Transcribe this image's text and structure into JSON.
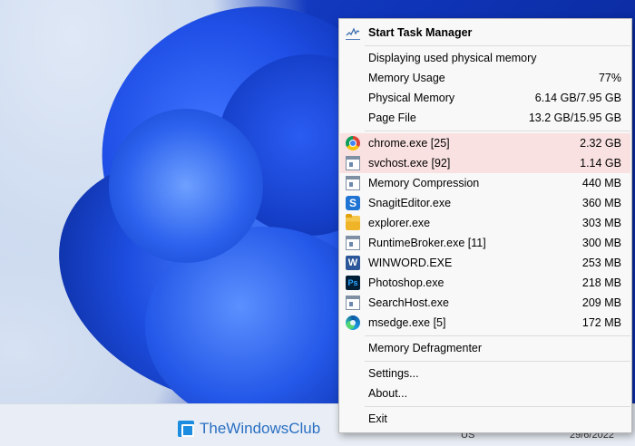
{
  "menu": {
    "header": {
      "label": "Start Task Manager",
      "icon": "task-manager-icon"
    },
    "info_title": "Displaying used physical memory",
    "stats": [
      {
        "label": "Memory Usage",
        "value": "77%"
      },
      {
        "label": "Physical Memory",
        "value": "6.14 GB/7.95 GB"
      },
      {
        "label": "Page File",
        "value": "13.2 GB/15.95 GB"
      }
    ],
    "processes": [
      {
        "label": "chrome.exe [25]",
        "value": "2.32 GB",
        "icon": "chrome-icon",
        "highlight": true
      },
      {
        "label": "svchost.exe [92]",
        "value": "1.14 GB",
        "icon": "window-app-icon",
        "highlight": true
      },
      {
        "label": "Memory Compression",
        "value": "440 MB",
        "icon": "window-app-icon",
        "highlight": false
      },
      {
        "label": "SnagitEditor.exe",
        "value": "360 MB",
        "icon": "snagit-icon",
        "highlight": false
      },
      {
        "label": "explorer.exe",
        "value": "303 MB",
        "icon": "folder-icon",
        "highlight": false
      },
      {
        "label": "RuntimeBroker.exe [11]",
        "value": "300 MB",
        "icon": "window-app-icon",
        "highlight": false
      },
      {
        "label": "WINWORD.EXE",
        "value": "253 MB",
        "icon": "word-icon",
        "highlight": false
      },
      {
        "label": "Photoshop.exe",
        "value": "218 MB",
        "icon": "photoshop-icon",
        "highlight": false
      },
      {
        "label": "SearchHost.exe",
        "value": "209 MB",
        "icon": "window-app-icon",
        "highlight": false
      },
      {
        "label": "msedge.exe [5]",
        "value": "172 MB",
        "icon": "edge-icon",
        "highlight": false
      }
    ],
    "defrag_label": "Memory Defragmenter",
    "settings_label": "Settings...",
    "about_label": "About...",
    "exit_label": "Exit",
    "highlight_color": "#fae1e1"
  },
  "icon_letters": {
    "snagit": "S",
    "word": "W",
    "photoshop": "Ps"
  },
  "taskbar": {
    "brand": "TheWindowsClub",
    "language": "US",
    "date": "29/6/2022"
  }
}
